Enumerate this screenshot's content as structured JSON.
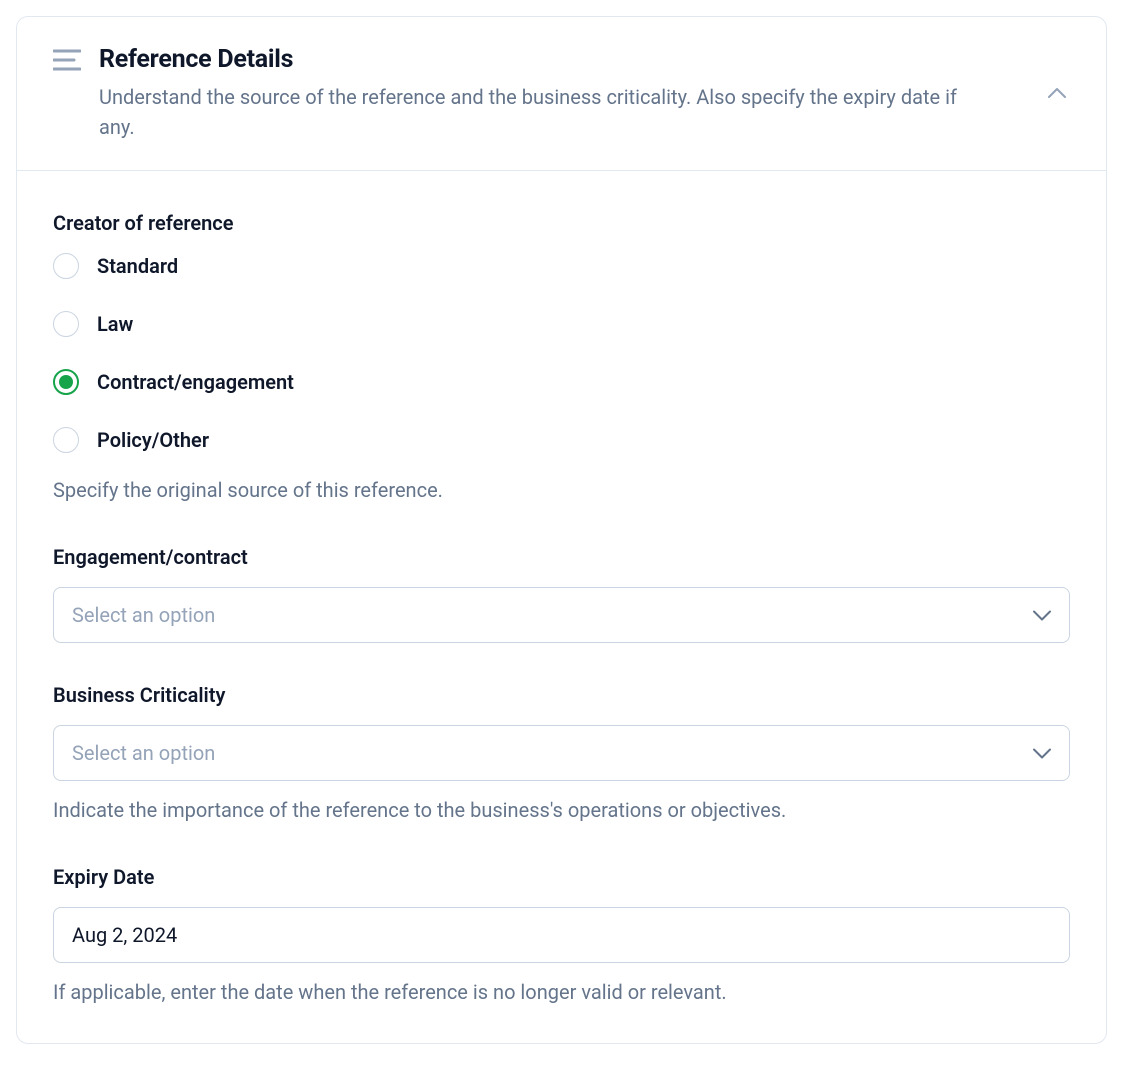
{
  "header": {
    "title": "Reference Details",
    "subtitle": "Understand the source of the reference and the business criticality. Also specify the expiry date if any."
  },
  "creator": {
    "label": "Creator of reference",
    "options": [
      {
        "label": "Standard",
        "selected": false
      },
      {
        "label": "Law",
        "selected": false
      },
      {
        "label": "Contract/engagement",
        "selected": true
      },
      {
        "label": "Policy/Other",
        "selected": false
      }
    ],
    "helper": "Specify the original source of this reference."
  },
  "engagement": {
    "label": "Engagement/contract",
    "placeholder": "Select an option"
  },
  "criticality": {
    "label": "Business Criticality",
    "placeholder": "Select an option",
    "helper": "Indicate the importance of the reference to the business's operations or objectives."
  },
  "expiry": {
    "label": "Expiry Date",
    "value": "Aug 2, 2024",
    "helper": "If applicable, enter the date when the reference is no longer valid or relevant."
  },
  "colors": {
    "accent": "#16a34a",
    "border": "#cbd5e1",
    "muted": "#64748b"
  }
}
